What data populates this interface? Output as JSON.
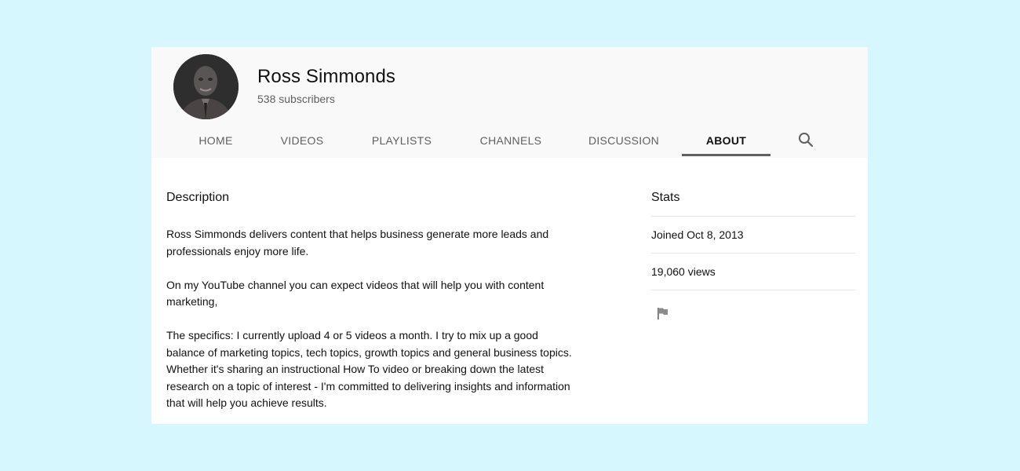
{
  "channel": {
    "name": "Ross Simmonds",
    "subscribers": "538 subscribers",
    "avatar_alt": "channel-avatar"
  },
  "tabs": [
    {
      "label": "HOME",
      "active": false
    },
    {
      "label": "VIDEOS",
      "active": false
    },
    {
      "label": "PLAYLISTS",
      "active": false
    },
    {
      "label": "CHANNELS",
      "active": false
    },
    {
      "label": "DISCUSSION",
      "active": false
    },
    {
      "label": "ABOUT",
      "active": true
    }
  ],
  "search_icon": "search-icon",
  "description": {
    "title": "Description",
    "paragraphs": [
      "Ross Simmonds delivers content that helps business generate more leads and professionals enjoy more life.",
      "On my YouTube channel you can expect videos that will help you with content marketing,",
      "The specifics: I currently upload 4 or 5 videos a month. I try to mix up a good balance of marketing topics, tech topics, growth topics and general business topics. Whether it's sharing an instructional How To video or breaking down the latest research on a topic of interest - I'm committed to delivering insights and information that will help you achieve results."
    ]
  },
  "stats": {
    "title": "Stats",
    "joined": "Joined Oct 8, 2013",
    "views": "19,060 views",
    "flag_icon": "flag-icon"
  },
  "colors": {
    "background": "#d7f7fe",
    "header_bg": "#f9f9f9",
    "tab_text": "#606060",
    "active_underline": "#606060"
  }
}
